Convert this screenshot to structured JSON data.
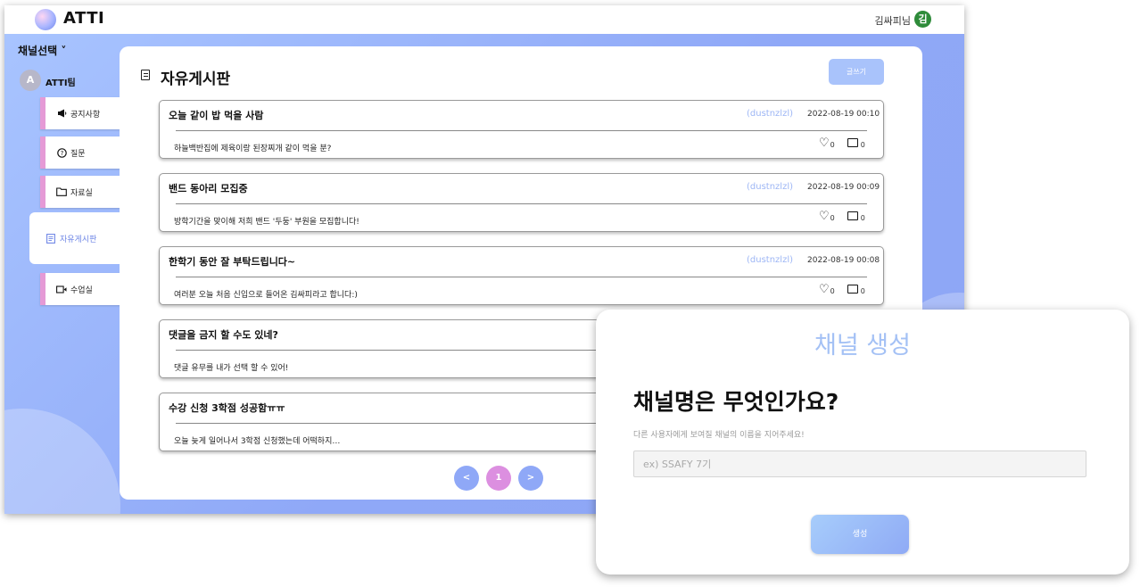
{
  "header": {
    "brand": "ATTI",
    "username": "김싸피님",
    "avatar_initial": "김"
  },
  "sidebar": {
    "channel_select": "채널선택 ˅",
    "team": {
      "avatar_initial": "A",
      "name": "ATTI팀"
    },
    "items": [
      {
        "icon": "megaphone-icon",
        "label": "공지사항"
      },
      {
        "icon": "question-icon",
        "label": "질문"
      },
      {
        "icon": "folder-icon",
        "label": "자료실"
      },
      {
        "icon": "board-icon",
        "label": "자유게시판",
        "active": true
      },
      {
        "icon": "video-icon",
        "label": "수업실"
      }
    ]
  },
  "board": {
    "title": "자유게시판",
    "write_label": "글쓰기",
    "posts": [
      {
        "title": "오늘 같이 밥 먹을 사람",
        "author": "(dustnzlzl)",
        "date": "2022-08-19 00:10",
        "body": "하늘백반집에 제육이랑 된장찌개 같이 먹을 분?",
        "likes": "0",
        "comments": "0"
      },
      {
        "title": "밴드 동아리 모집중",
        "author": "(dustnzlzl)",
        "date": "2022-08-19 00:09",
        "body": "방학기간을 맞이해 저희 밴드 '두둥' 부원을 모집합니다!",
        "likes": "0",
        "comments": "0"
      },
      {
        "title": "한학기 동안 잘 부탁드립니다~",
        "author": "(dustnzlzl)",
        "date": "2022-08-19 00:08",
        "body": "여러분 오늘 처음 신입으로 들어온 김싸피라고 합니다:)",
        "likes": "0",
        "comments": "0"
      },
      {
        "title": "댓글을 금지 할 수도 있네?",
        "body": "댓글 유무를 내가 선택 할 수 있어!"
      },
      {
        "title": "수강 신청 3학점 성공함ㅠㅠ",
        "body": "오늘 늦게 일어나서 3학점 신청했는데 어떡하지…"
      }
    ],
    "pagination": {
      "prev": "<",
      "current": "1",
      "next": ">"
    }
  },
  "modal": {
    "title": "채널 생성",
    "question": "채널명은 무엇인가요?",
    "help": "다른 사용자에게 보여질 채널의 이름을 지어주세요!",
    "input_placeholder": "ex) SSAFY 7기",
    "input_value": "",
    "create_label": "생성"
  },
  "colors": {
    "accent": "#8fa8f7",
    "menu_marker": "#e59ad6",
    "author": "#9db6f5",
    "page_current": "#dc8fe0",
    "page_nav": "#8fa8f7",
    "avatar": "#2e8b3a"
  }
}
